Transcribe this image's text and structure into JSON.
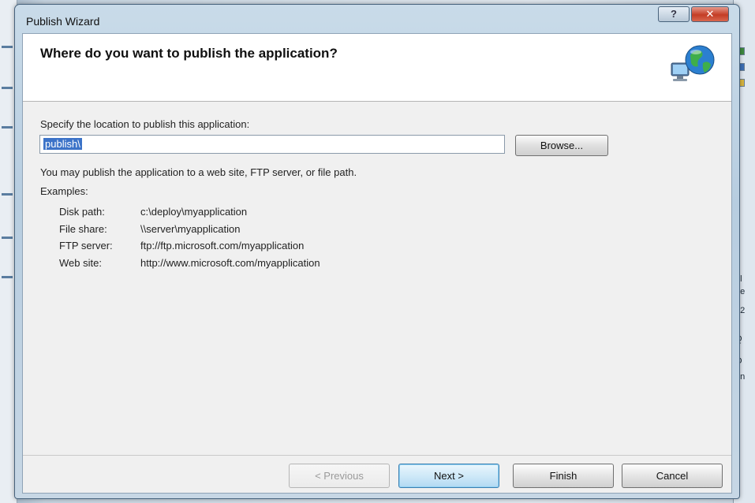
{
  "window": {
    "title": "Publish Wizard",
    "help_label": "?",
    "close_label": "✕"
  },
  "header": {
    "heading": "Where do you want to publish the application?",
    "icon": "globe-network-icon"
  },
  "location": {
    "prompt": "Specify the location to publish this application:",
    "value": "publish\\",
    "browse_label": "Browse..."
  },
  "info": "You may publish the application to a web site, FTP server, or file path.",
  "examples": {
    "heading": "Examples:",
    "rows": [
      {
        "label": "Disk path:",
        "value": "c:\\deploy\\myapplication"
      },
      {
        "label": "File share:",
        "value": "\\\\server\\myapplication"
      },
      {
        "label": "FTP server:",
        "value": "ftp://ftp.microsoft.com/myapplication"
      },
      {
        "label": "Web site:",
        "value": "http://www.microsoft.com/myapplication"
      }
    ]
  },
  "buttons": {
    "previous": "< Previous",
    "next": "Next >",
    "finish": "Finish",
    "cancel": "Cancel"
  },
  "background_app": {
    "right_fragments": [
      "pl",
      "pe",
      "12",
      "Q",
      "O",
      "en"
    ]
  },
  "colors": {
    "selection": "#3c73c8",
    "close_button": "#c43d25",
    "header_bg": "#ffffff",
    "dialog_bg": "#f0f0f0"
  }
}
